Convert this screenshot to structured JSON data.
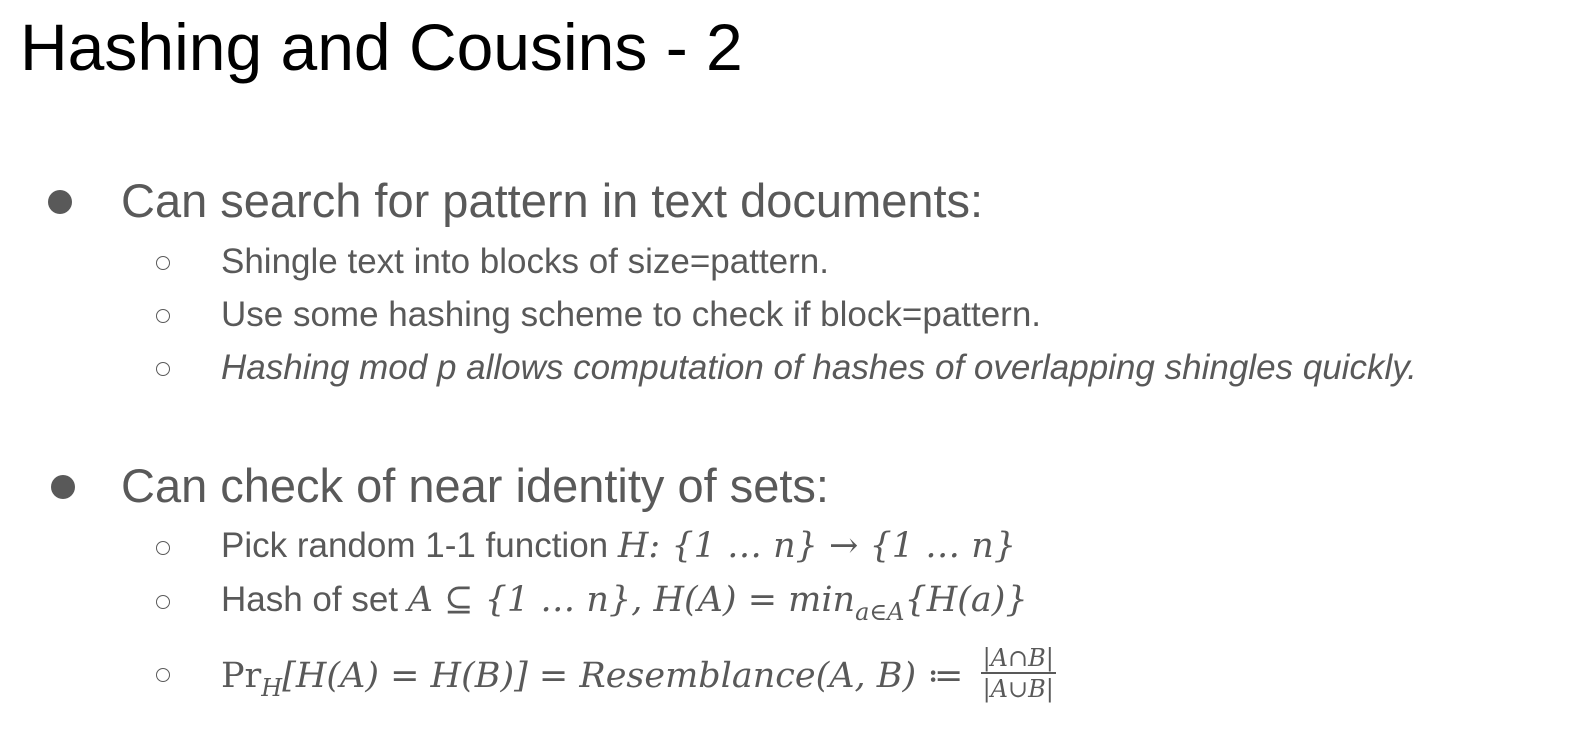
{
  "slide": {
    "title": "Hashing and Cousins - 2"
  },
  "sections": [
    {
      "heading": "Can search for pattern in text documents:",
      "items": [
        "Shingle text into blocks of size=pattern.",
        "Use some hashing scheme to check if block=pattern.",
        "Hashing mod p allows computation of hashes of overlapping shingles quickly."
      ]
    },
    {
      "heading": "Can check of near identity of sets:",
      "items": [
        {
          "text": "Pick random 1-1 function ",
          "math": "H: {1 … n} → {1 … n}"
        },
        {
          "text": "Hash of set ",
          "math_a": "A ⊆ {1 … n}, H(A) = min",
          "math_sub": "a∈A",
          "math_b": "{H(a)}"
        },
        {
          "math_a": "Pr",
          "math_sub": "H",
          "math_b": "[H(A) = H(B)] = Resemblance(A, B) ≔ ",
          "frac_num": "|A∩B|",
          "frac_den": "|A∪B|"
        }
      ]
    }
  ]
}
